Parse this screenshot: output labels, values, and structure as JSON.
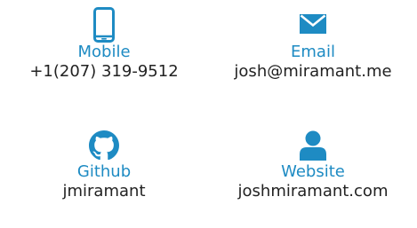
{
  "colors": {
    "accent": "#1e8bc3",
    "text": "#222222"
  },
  "contacts": [
    {
      "icon": "mobile-phone-icon",
      "label": "Mobile",
      "value": "+1(207) 319-9512"
    },
    {
      "icon": "envelope-icon",
      "label": "Email",
      "value": "josh@miramant.me"
    },
    {
      "icon": "github-icon",
      "label": "Github",
      "value": "jmiramant"
    },
    {
      "icon": "person-icon",
      "label": "Website",
      "value": "joshmiramant.com"
    }
  ]
}
